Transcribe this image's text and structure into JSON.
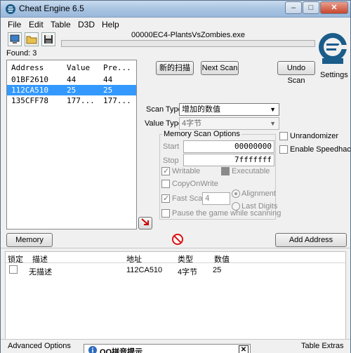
{
  "window": {
    "title": "Cheat Engine 6.5",
    "min_label": "–",
    "max_label": "□",
    "close_label": "✕"
  },
  "menu": [
    "File",
    "Edit",
    "Table",
    "D3D",
    "Help"
  ],
  "process_name": "00000EC4-PlantsVsZombies.exe",
  "found": "Found: 3",
  "settings_label": "Settings",
  "results": {
    "headers": [
      "Address",
      "Value",
      "Pre..."
    ],
    "rows": [
      {
        "address": "01BF2610",
        "value": "44",
        "previous": "44",
        "selected": false
      },
      {
        "address": "112CA510",
        "value": "25",
        "previous": "25",
        "selected": true
      },
      {
        "address": "135CFF78",
        "value": "177...",
        "previous": "177...",
        "selected": false
      }
    ]
  },
  "buttons": {
    "new_scan": "新的扫描",
    "next_scan": "Next Scan",
    "undo_scan": "Undo Scan",
    "memory_view": "Memory View",
    "add_address": "Add Address Manually"
  },
  "scan_type": {
    "label": "Scan Type",
    "value": "增加的数值"
  },
  "value_type": {
    "label": "Value Type",
    "value": "4字节"
  },
  "memory_scan_options": {
    "title": "Memory Scan Options",
    "start_label": "Start",
    "start_value": "00000000",
    "stop_label": "Stop",
    "stop_value": "7fffffff",
    "writable": "Writable",
    "executable": "Executable",
    "copy_on_write": "CopyOnWrite",
    "fast_scan": "Fast Scan",
    "fast_scan_value": "4",
    "alignment": "Alignment",
    "last_digits": "Last Digits",
    "pause_game": "Pause the game while scanning"
  },
  "unrandomizer": "Unrandomizer",
  "enable_speedhack": "Enable Speedhack",
  "address_table": {
    "headers": [
      "锁定",
      "描述",
      "地址",
      "类型",
      "数值"
    ],
    "rows": [
      {
        "description": "无描述",
        "address": "112CA510",
        "type": "4字节",
        "value": "25"
      }
    ]
  },
  "statusbar": {
    "advanced_options": "Advanced Options",
    "table_extras": "Table Extras"
  },
  "popup": {
    "title": "QQ拼音提示",
    "close": "✕"
  },
  "colors": {
    "selection": "#3399ff",
    "titlebar": "#a9c4e2",
    "logo": "#1a5c8a"
  }
}
